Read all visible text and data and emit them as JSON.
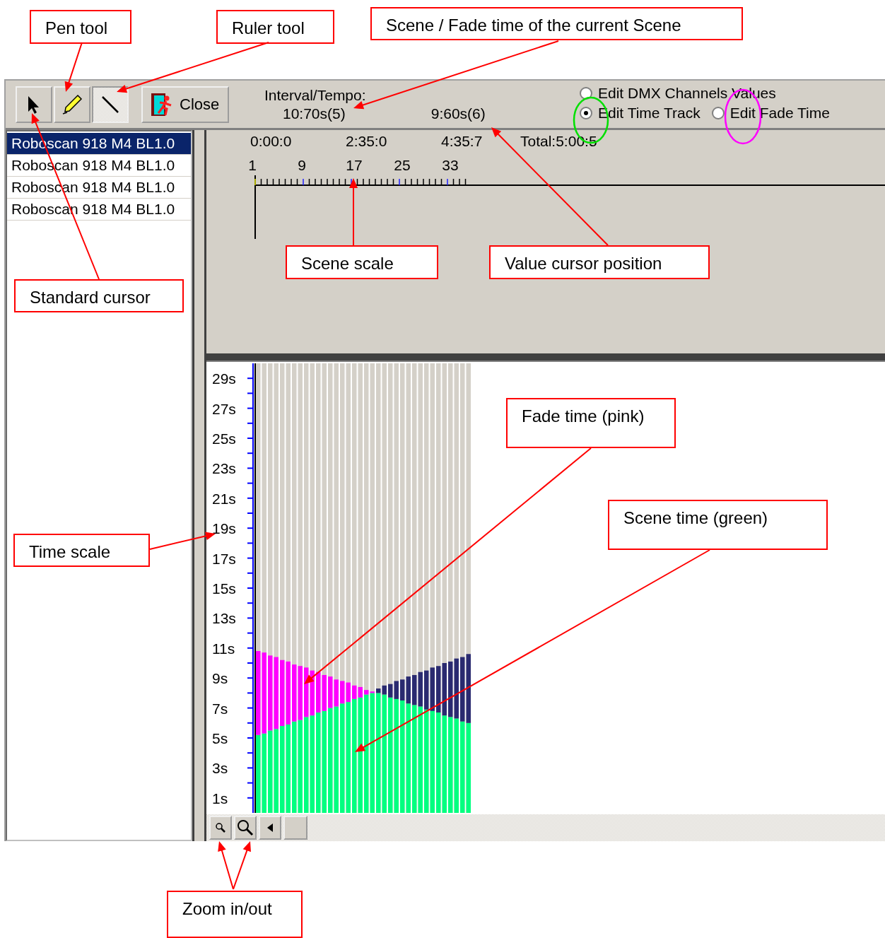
{
  "toolbar": {
    "tools": [
      {
        "kind": "pointer",
        "selected": false
      },
      {
        "kind": "pen",
        "selected": false
      },
      {
        "kind": "ruler",
        "selected": true
      }
    ],
    "close_button": "Close",
    "interval_label": "Interval/Tempo:",
    "interval_value": "10:70s(5)",
    "fade_value": "9:60s(6)",
    "modes": [
      {
        "label": "Edit DMX Channels Values",
        "selected": false
      },
      {
        "label": "Edit Time Track",
        "selected": true
      },
      {
        "label": "Edit Fade Time",
        "selected": false
      }
    ]
  },
  "fixtures": [
    {
      "label": "Roboscan 918 M4 BL1.0",
      "selected": true
    },
    {
      "label": "Roboscan 918 M4 BL1.0",
      "selected": false
    },
    {
      "label": "Roboscan 918 M4 BL1.0",
      "selected": false
    },
    {
      "label": "Roboscan 918 M4 BL1.0",
      "selected": false
    }
  ],
  "timeline": {
    "times": [
      "0:00:0",
      "2:35:0",
      "4:35:7"
    ],
    "total": "Total:5:00:5",
    "scene_numbers": [
      "1",
      "9",
      "17",
      "25",
      "33"
    ]
  },
  "chart": {
    "chart_data": {
      "type": "bar",
      "stacked": true,
      "ylim": [
        0,
        30
      ],
      "yticks": [
        {
          "value": 1,
          "label": "1s"
        },
        {
          "value": 3,
          "label": "3s"
        },
        {
          "value": 5,
          "label": "5s"
        },
        {
          "value": 7,
          "label": "7s"
        },
        {
          "value": 9,
          "label": "9s"
        },
        {
          "value": 11,
          "label": "11s"
        },
        {
          "value": 13,
          "label": "13s"
        },
        {
          "value": 15,
          "label": "15s"
        },
        {
          "value": 17,
          "label": "17s"
        },
        {
          "value": 19,
          "label": "19s"
        },
        {
          "value": 21,
          "label": "21s"
        },
        {
          "value": 23,
          "label": "23s"
        },
        {
          "value": 25,
          "label": "25s"
        },
        {
          "value": 27,
          "label": "27s"
        },
        {
          "value": 29,
          "label": "29s"
        }
      ],
      "series": [
        {
          "color": "#00ff80",
          "values": [
            5.2,
            5.3,
            5.5,
            5.6,
            5.8,
            5.9,
            6.1,
            6.2,
            6.4,
            6.5,
            6.7,
            6.8,
            7.0,
            7.1,
            7.3,
            7.4,
            7.6,
            7.7,
            7.9,
            8.0,
            8.0,
            7.9,
            7.7,
            7.6,
            7.5,
            7.3,
            7.2,
            7.1,
            6.9,
            6.8,
            6.7,
            6.5,
            6.4,
            6.3,
            6.1,
            6.0
          ]
        },
        {
          "color": "#ff00ff",
          "values": [
            5.6,
            5.4,
            5.0,
            4.8,
            4.4,
            4.2,
            3.8,
            3.6,
            3.3,
            3.0,
            2.7,
            2.4,
            2.1,
            1.8,
            1.5,
            1.3,
            0.9,
            0.7,
            0.3,
            0.1,
            null,
            null,
            null,
            null,
            null,
            null,
            null,
            null,
            null,
            null,
            null,
            null,
            null,
            null,
            null,
            null
          ]
        },
        {
          "color": "#2a2a70",
          "values": [
            null,
            null,
            null,
            null,
            null,
            null,
            null,
            null,
            null,
            null,
            null,
            null,
            null,
            null,
            null,
            null,
            null,
            null,
            null,
            null,
            0.3,
            0.6,
            0.9,
            1.2,
            1.4,
            1.8,
            2.0,
            2.3,
            2.6,
            2.9,
            3.1,
            3.5,
            3.7,
            4.0,
            4.3,
            4.6
          ]
        }
      ]
    }
  },
  "annotations": [
    {
      "text": "Pen tool"
    },
    {
      "text": "Ruler tool"
    },
    {
      "text": "Scene / Fade time of the current Scene"
    },
    {
      "text": "Standard cursor"
    },
    {
      "text": "Scene scale"
    },
    {
      "text": "Value cursor position"
    },
    {
      "text": "Fade time (pink)"
    },
    {
      "text": "Scene time (green)"
    },
    {
      "text": "Time scale"
    },
    {
      "text": "Zoom in/out"
    }
  ]
}
